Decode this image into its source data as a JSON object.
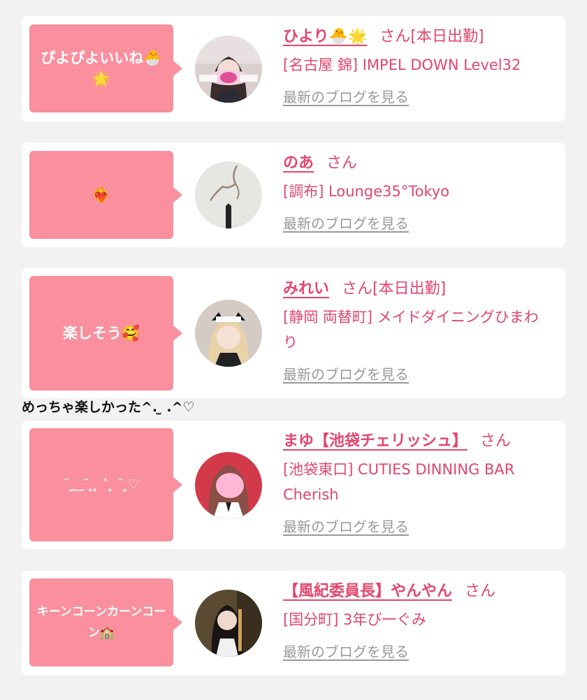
{
  "cards": [
    {
      "bubble": "ぴよぴよいいね🐣🌟",
      "name": "ひより🐣🌟",
      "san": "さん[本日出勤]",
      "shop": "[名古屋 錦] IMPEL DOWN Level32",
      "blog": "最新のブログを見る"
    },
    {
      "bubble": "❤️‍🔥",
      "name": "のあ",
      "san": "さん",
      "shop": "[調布] Lounge35°Tokyo",
      "blog": "最新のブログを見る"
    },
    {
      "bubble": "楽しそう🥰",
      "name": "みれい",
      "san": "さん[本日出勤]",
      "shop": "[静岡 両替町] メイドダイニングひまわり",
      "blog": "最新のブログを見る"
    },
    {
      "bubble": "˘ ͈ ͜ ˘ ̥ ̥ ˂ ̥ ˘ ͈♡",
      "name": "まゆ【池袋チェリッシュ】",
      "san": "さん",
      "shop": "[池袋東口] CUTIES DINNING BAR Cherish",
      "blog": "最新のブログを見る"
    },
    {
      "bubble": "キーンコーンカーンコーン🏫",
      "name": "【風紀委員長】やんやん",
      "san": "さん",
      "shop": "[国分町] 3年び一ぐみ",
      "blog": "最新のブログを見る"
    }
  ],
  "between_text": "めっちゃ楽しかった^. ̫ .^♡",
  "colors": {
    "bubble": "#fa8f9d",
    "accent": "#e3466d",
    "link_gray": "#999999"
  }
}
